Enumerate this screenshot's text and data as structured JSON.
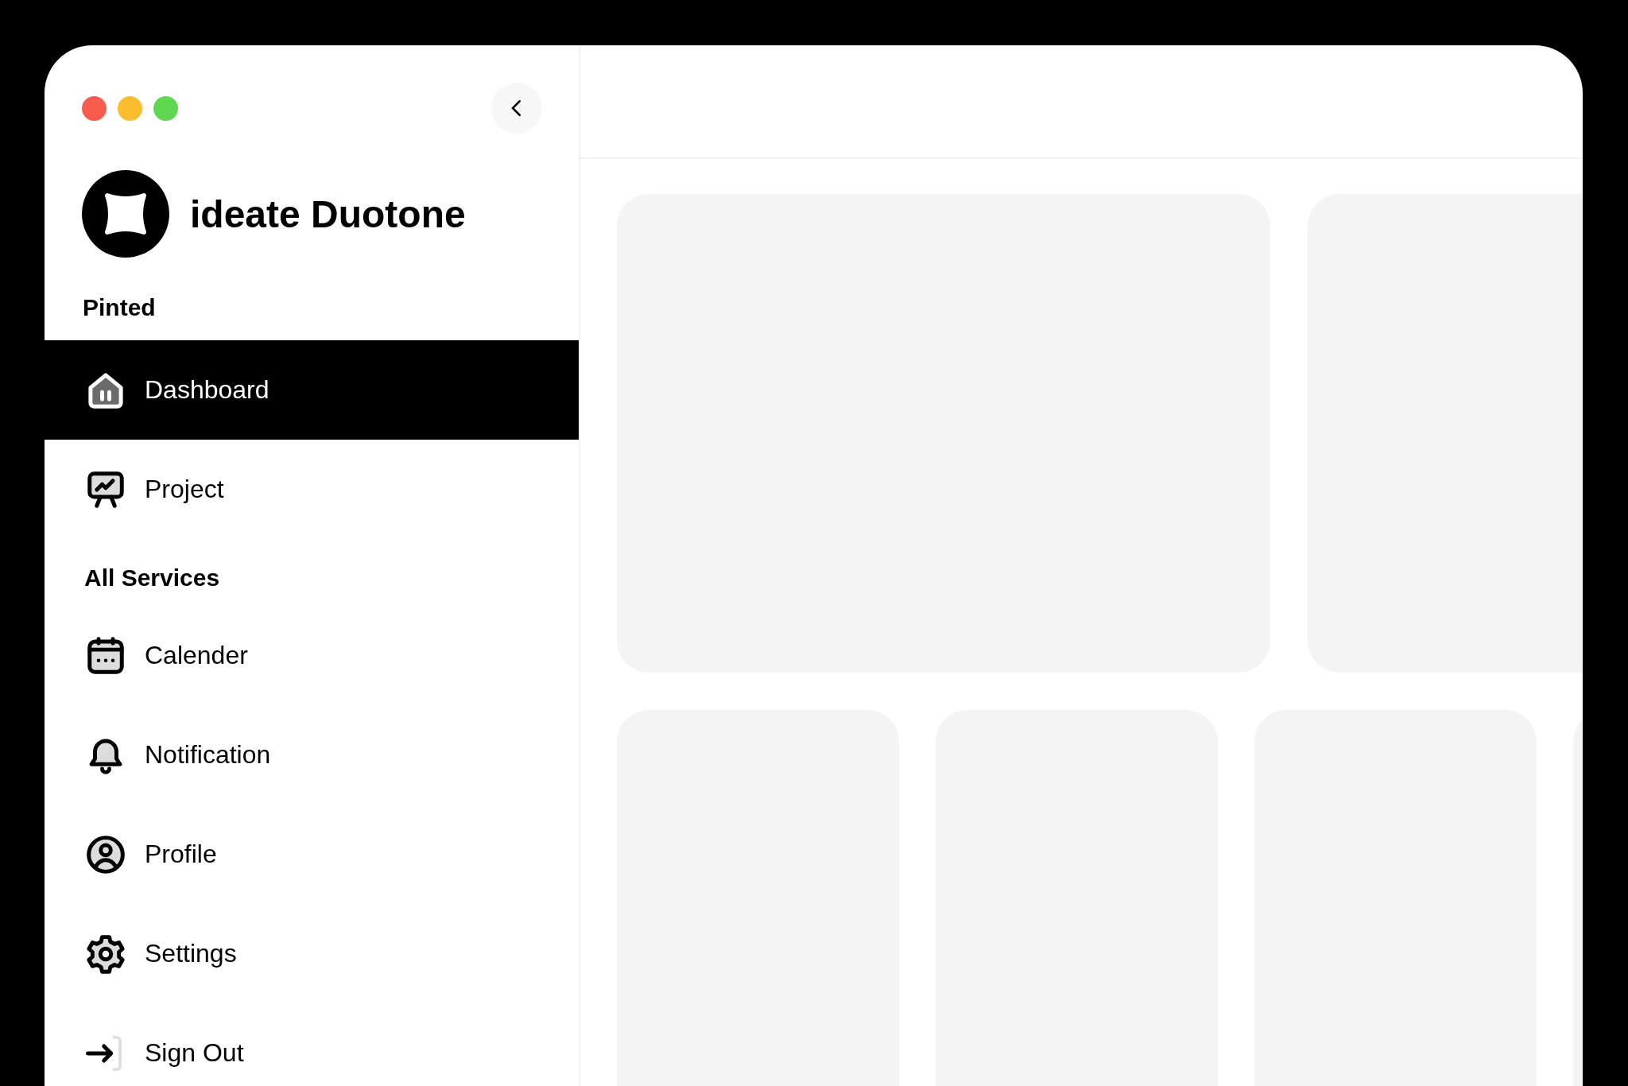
{
  "brand": {
    "name": "ideate Duotone"
  },
  "sidebar": {
    "sections": [
      {
        "title": "Pinted",
        "items": [
          {
            "label": "Dashboard",
            "selected": true
          },
          {
            "label": "Project",
            "selected": false
          }
        ]
      },
      {
        "title": "All Services",
        "items": [
          {
            "label": "Calender",
            "selected": false
          },
          {
            "label": "Notification",
            "selected": false
          },
          {
            "label": "Profile",
            "selected": false
          },
          {
            "label": "Settings",
            "selected": false
          },
          {
            "label": "Sign Out",
            "selected": false
          }
        ]
      }
    ]
  }
}
